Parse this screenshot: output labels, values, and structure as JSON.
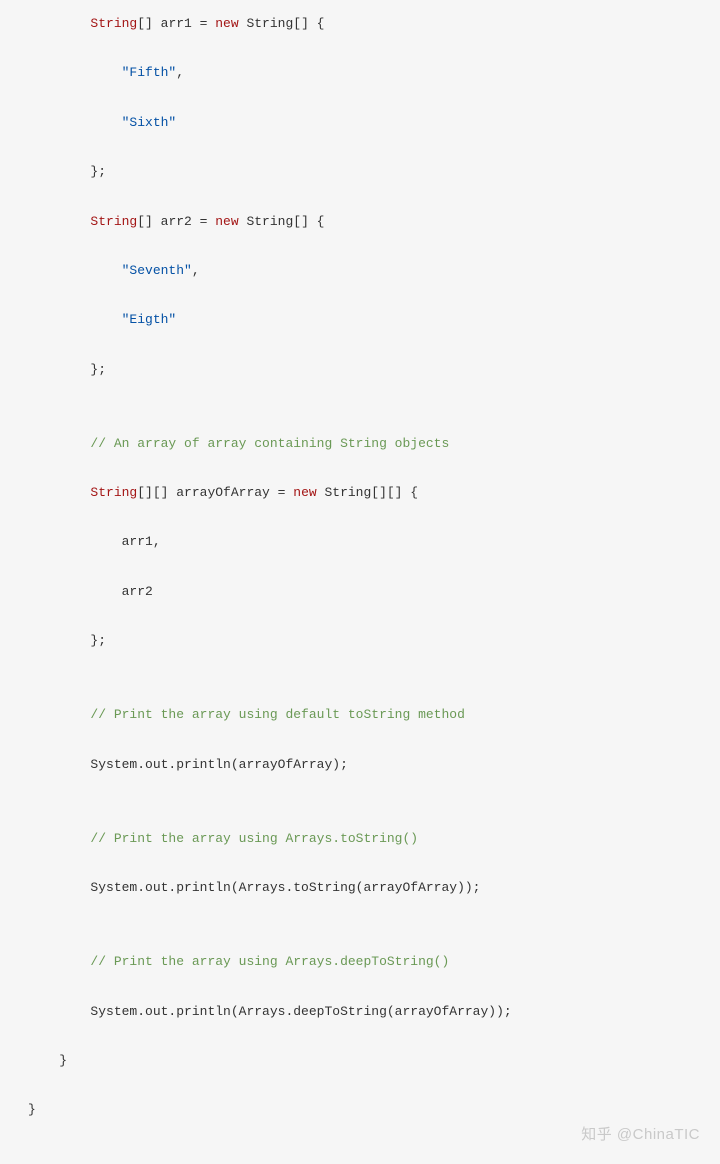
{
  "code": {
    "indent1": "        ",
    "indent2": "            ",
    "indent0_close": "    }",
    "indent_neg_close": "}",
    "line01_a": "String",
    "line01_b": "[] arr1 = ",
    "line01_c": "new",
    "line01_d": " String[] {",
    "line02_str": "\"Fifth\"",
    "line02_comma": ",",
    "line03_str": "\"Sixth\"",
    "line04": "};",
    "line05_a": "String",
    "line05_b": "[] arr2 = ",
    "line05_c": "new",
    "line05_d": " String[] {",
    "line06_str": "\"Seventh\"",
    "line06_comma": ",",
    "line07_str": "\"Eigth\"",
    "line08": "};",
    "blank": "",
    "line10_comment": "// An array of array containing String objects",
    "line11_a": "String",
    "line11_b": "[][] arrayOfArray = ",
    "line11_c": "new",
    "line11_d": " String[][] {",
    "line12": "arr1,",
    "line13": "arr2",
    "line14": "};",
    "line16_comment": "// Print the array using default toString method",
    "line17": "System.out.println(arrayOfArray);",
    "line19_comment": "// Print the array using Arrays.toString()",
    "line20": "System.out.println(Arrays.toString(arrayOfArray));",
    "line22_comment": "// Print the array using Arrays.deepToString()",
    "line23": "System.out.println(Arrays.deepToString(arrayOfArray));"
  },
  "watermark": "知乎 @ChinaTIC"
}
